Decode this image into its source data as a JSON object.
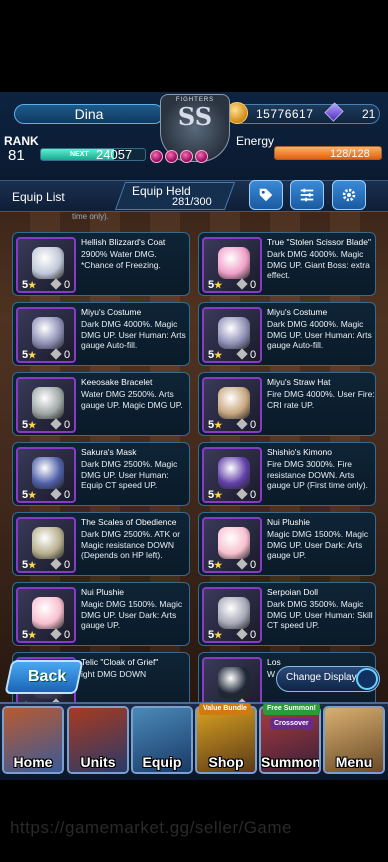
{
  "header": {
    "player_name": "Dina",
    "gold": "15776617",
    "gems": "21",
    "rank_label": "RANK",
    "rank": "81",
    "next_label": "NEXT",
    "next_exp": "24057",
    "rank_progress": 0.7,
    "energy_label": "Energy",
    "energy": "128/128",
    "energy_progress": 1.0,
    "emblem_top": "FIGHTERS",
    "emblem_rank": "SS",
    "orb_count": 4
  },
  "equip_bar": {
    "title": "Equip List",
    "capacity_label": "Equip Held",
    "capacity_value": "281/300",
    "buttons": [
      "tag-icon",
      "sort-icon",
      "gear-icon"
    ]
  },
  "partial_top_text": "time only).",
  "items": [
    {
      "name": "Hellish Blizzard's Coat",
      "desc": "2900% Water DMG. *Chance of Freezing.",
      "stars": "5",
      "level": "0",
      "frame": "#8a3ac8",
      "art": "#c0c8d8"
    },
    {
      "name": "True \"Stolen Scissor Blade\"",
      "desc": "Dark DMG 4000%. Magic DMG UP. Giant Boss: extra effect.",
      "stars": "5",
      "level": "0",
      "frame": "#8a3ac8",
      "art": "#f0a0c8"
    },
    {
      "name": "Miyu's Costume",
      "desc": "Dark DMG 4000%. Magic DMG UP. User Human: Arts gauge Auto-fill.",
      "stars": "5",
      "level": "0",
      "frame": "#8a3ac8",
      "art": "#9090b8"
    },
    {
      "name": "Miyu's Costume",
      "desc": "Dark DMG 4000%. Magic DMG UP. User Human: Arts gauge Auto-fill.",
      "stars": "5",
      "level": "0",
      "frame": "#8a3ac8",
      "art": "#9090b8"
    },
    {
      "name": "Keeosake Bracelet",
      "desc": "Water DMG 2500%. Arts gauge UP. Magic DMG UP.",
      "stars": "5",
      "level": "0",
      "frame": "#8a3ac8",
      "art": "#a0a8a8"
    },
    {
      "name": "Miyu's Straw Hat",
      "desc": "Fire DMG 4000%. User Fire: CRI rate UP.",
      "stars": "5",
      "level": "0",
      "frame": "#8a3ac8",
      "art": "#c8a880"
    },
    {
      "name": "Sakura's Mask",
      "desc": "Dark DMG 2500%. Magic DMG UP. User Human: Equip CT speed UP.",
      "stars": "5",
      "level": "0",
      "frame": "#8a3ac8",
      "art": "#5060a8"
    },
    {
      "name": "Shishio's Kimono",
      "desc": "Fire DMG 3000%. Fire resistance DOWN. Arts gauge UP (First time only).",
      "stars": "5",
      "level": "0",
      "frame": "#8a3ac8",
      "art": "#6040a8"
    },
    {
      "name": "The Scales of Obedience",
      "desc": "Dark DMG 2500%. ATK or Magic resistance DOWN (Depends on HP left).",
      "stars": "5",
      "level": "0",
      "frame": "#8a3ac8",
      "art": "#b8b090"
    },
    {
      "name": "Nui Plushie",
      "desc": "Magic DMG 1500%. Magic DMG UP. User Dark: Arts gauge UP.",
      "stars": "5",
      "level": "0",
      "frame": "#8a3ac8",
      "art": "#f8c0d0"
    },
    {
      "name": "Nui Plushie",
      "desc": "Magic DMG 1500%. Magic DMG UP. User Dark: Arts gauge UP.",
      "stars": "5",
      "level": "0",
      "frame": "#8a3ac8",
      "art": "#f8c0d0"
    },
    {
      "name": "Serpoian Doll",
      "desc": "Dark DMG 3500%. Magic DMG UP. User Human: Skill CT speed UP.",
      "stars": "5",
      "level": "0",
      "frame": "#8a3ac8",
      "art": "#a8a8b8"
    },
    {
      "name": "Telic \"Cloak of Grief\"",
      "desc": "ight DMG DOWN",
      "stars": "",
      "level": "",
      "frame": "#8a3ac8",
      "art": "#404060"
    },
    {
      "name": "Los",
      "desc": "W",
      "stars": "",
      "level": "",
      "frame": "#8a3ac8",
      "art": "#202838"
    }
  ],
  "buttons": {
    "back": "Back",
    "change_display": "Change Display"
  },
  "nav": [
    {
      "label": "Home",
      "badge": "",
      "color1": "#b85a30",
      "color2": "#3a5a98"
    },
    {
      "label": "Units",
      "badge": "",
      "color1": "#a83a20",
      "color2": "#2a3a68"
    },
    {
      "label": "Equip",
      "badge": "",
      "color1": "#4a8ab8",
      "color2": "#1a3a68"
    },
    {
      "label": "Shop",
      "badge": "Value Bundle",
      "color1": "#d8a020",
      "color2": "#5a3a18"
    },
    {
      "label": "Summon",
      "badge": "Free Summon!",
      "color1": "#a83a40",
      "color2": "#3a2038"
    },
    {
      "label": "Menu",
      "badge": "",
      "color1": "#d8b070",
      "color2": "#6a4a28"
    }
  ],
  "nav_overlay": "Crossover",
  "watermark": "https://gamemarket.gg/seller/Game"
}
